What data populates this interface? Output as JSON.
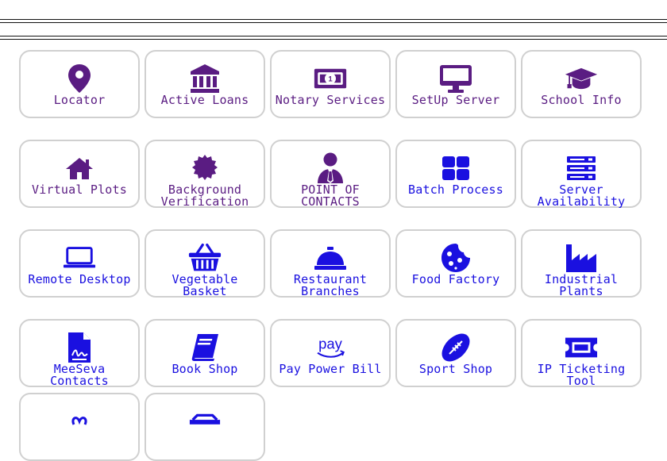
{
  "colors": {
    "purple": "#5a1c82",
    "blue": "#1a10e0",
    "tile_border": "#d0d0d0"
  },
  "tiles": [
    {
      "label": "Locator",
      "icon": "map-pin-icon",
      "color": "purple"
    },
    {
      "label": "Active Loans",
      "icon": "bank-icon",
      "color": "purple"
    },
    {
      "label": "Notary Services",
      "icon": "money-bill-icon",
      "color": "purple"
    },
    {
      "label": "SetUp Server",
      "icon": "monitor-icon",
      "color": "purple"
    },
    {
      "label": "School Info",
      "icon": "graduation-cap-icon",
      "color": "purple"
    },
    {
      "label": "Virtual Plots",
      "icon": "house-icon",
      "color": "purple"
    },
    {
      "label": "Background\nVerification",
      "icon": "certificate-icon",
      "color": "purple"
    },
    {
      "label": "POINT OF\nCONTACTS",
      "icon": "user-tie-icon",
      "color": "purple"
    },
    {
      "label": "Batch Process",
      "icon": "grid-icon",
      "color": "blue"
    },
    {
      "label": "Server\nAvailability",
      "icon": "server-icon",
      "color": "blue"
    },
    {
      "label": "Remote Desktop",
      "icon": "laptop-icon",
      "color": "blue"
    },
    {
      "label": "Vegetable\nBasket",
      "icon": "basket-icon",
      "color": "blue"
    },
    {
      "label": "Restaurant\nBranches",
      "icon": "concierge-bell-icon",
      "color": "blue"
    },
    {
      "label": "Food Factory",
      "icon": "cookie-icon",
      "color": "blue"
    },
    {
      "label": "Industrial\nPlants",
      "icon": "factory-icon",
      "color": "blue"
    },
    {
      "label": "MeeSeva\nContacts",
      "icon": "file-signature-icon",
      "color": "blue"
    },
    {
      "label": "Book Shop",
      "icon": "book-icon",
      "color": "blue"
    },
    {
      "label": "Pay Power Bill",
      "icon": "amazon-pay-icon",
      "color": "blue",
      "icon_text": "pay"
    },
    {
      "label": "Sport Shop",
      "icon": "football-icon",
      "color": "blue"
    },
    {
      "label": "IP Ticketing\nTool",
      "icon": "ticket-icon",
      "color": "blue"
    },
    {
      "label": "",
      "icon": "ribbon-icon",
      "color": "blue"
    },
    {
      "label": "",
      "icon": "store-icon",
      "color": "blue"
    }
  ]
}
